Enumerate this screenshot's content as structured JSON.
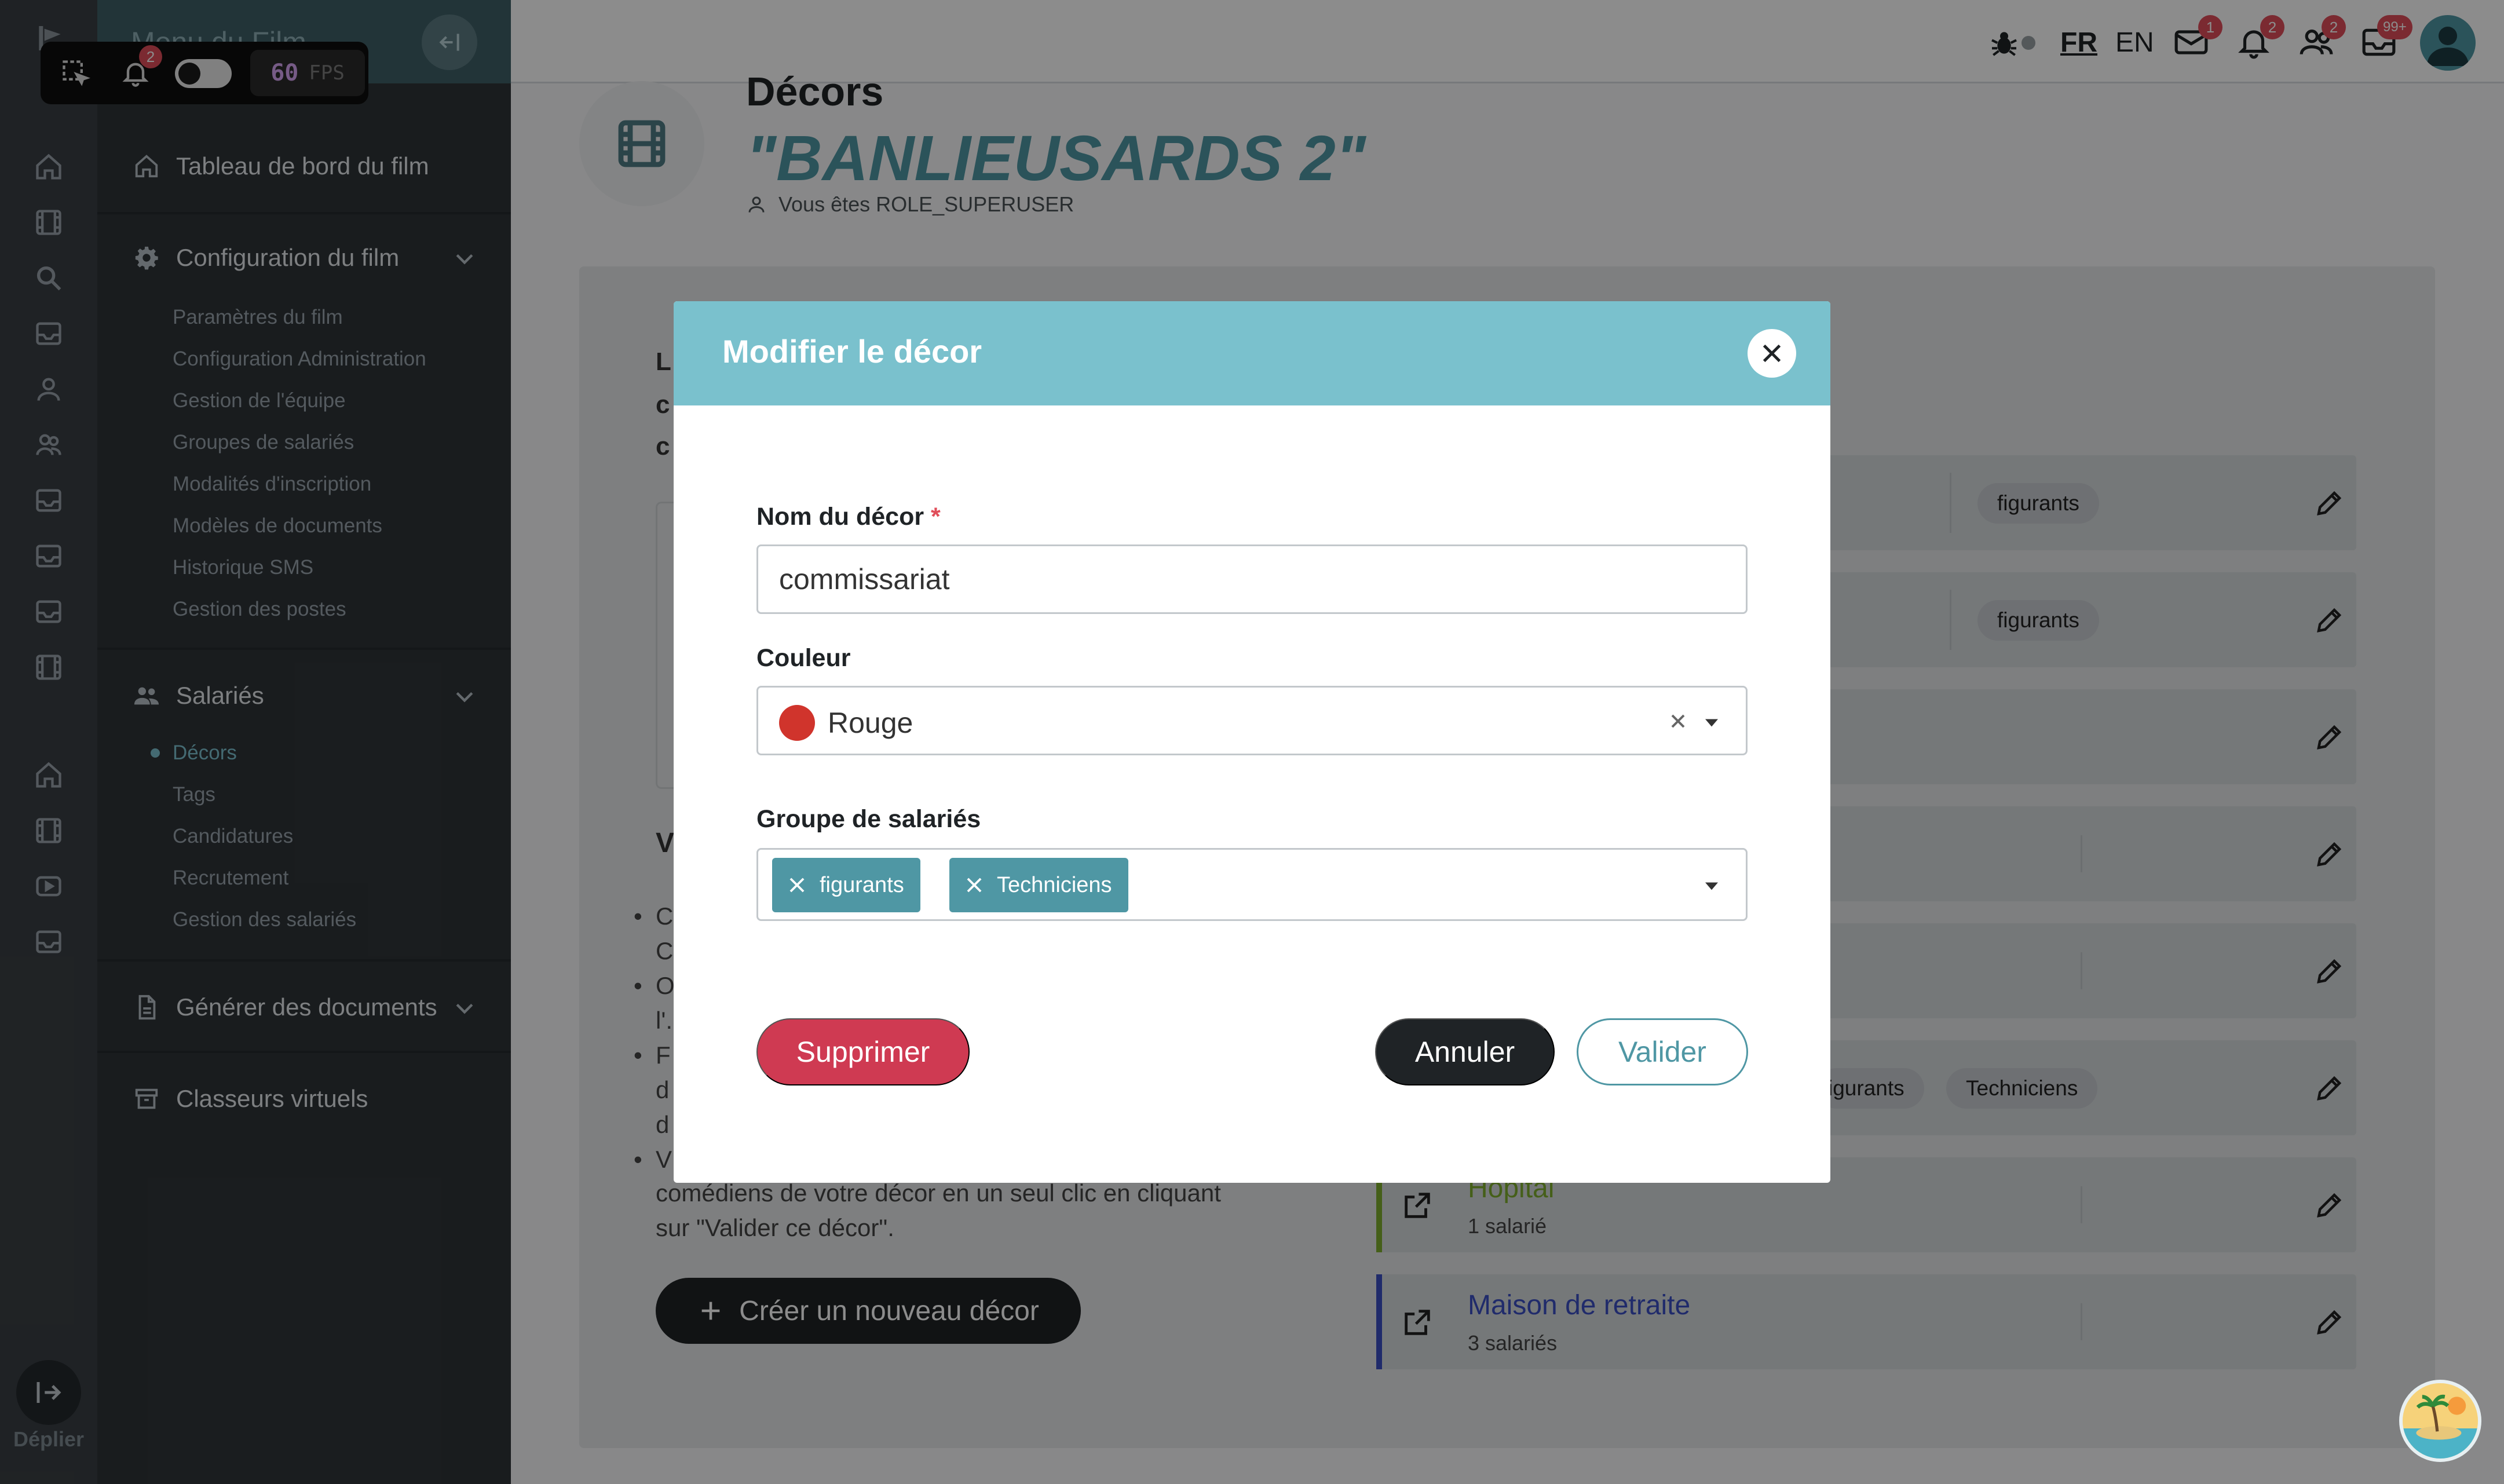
{
  "sidebar": {
    "header_title": "Menu du Film",
    "dashboard": "Tableau de bord du film",
    "config_section": "Configuration du film",
    "config_items": [
      "Paramètres du film",
      "Configuration Administration",
      "Gestion de l'équipe",
      "Groupes de salariés",
      "Modalités d'inscription",
      "Modèles de documents",
      "Historique SMS",
      "Gestion des postes"
    ],
    "salaries_section": "Salariés",
    "salaries_items": [
      "Décors",
      "Tags",
      "Candidatures",
      "Recrutement",
      "Gestion des salariés"
    ],
    "documents_section": "Générer des documents",
    "binders_section": "Classeurs virtuels"
  },
  "rail": {
    "expand_label": "Déplier"
  },
  "fps": {
    "value": "60",
    "label": "FPS",
    "bell_badge": "2"
  },
  "topbar": {
    "lang_fr": "FR",
    "lang_en": "EN",
    "badges": {
      "messages": "1",
      "notifications": "2",
      "users": "2",
      "mail": "99+"
    }
  },
  "page": {
    "kicker": "Décors",
    "title": "\"BANLIEUSARDS 2\"",
    "role": "Vous êtes ROLE_SUPERUSER"
  },
  "content": {
    "frag_l": "L",
    "frag_c1": "c",
    "frag_c2": "c",
    "frag_v": "V",
    "bullet_frags": [
      "C",
      "C",
      "O",
      "l'.",
      "F",
      "d",
      "d",
      "V"
    ],
    "bottom_text_1": "comédiens de votre décor en un seul clic en cliquant",
    "bottom_text_2": "sur \"Valider ce décor\".",
    "create_button": "Créer un nouveau décor",
    "rows": [
      {
        "tags": [
          "figurants"
        ]
      },
      {
        "tags": [
          "figurants"
        ]
      },
      {
        "tags": []
      },
      {
        "tags": []
      },
      {
        "tags": []
      },
      {
        "tags": [
          "igurants",
          "Techniciens"
        ]
      },
      {
        "name": "Hopital",
        "count": "1 salarié",
        "color": "#7fae2e"
      },
      {
        "name": "Maison de retraite",
        "count": "3 salariés",
        "color": "#3b4fc4"
      }
    ]
  },
  "modal": {
    "title": "Modifier le décor",
    "name_label": "Nom du décor",
    "required_mark": "*",
    "name_value": "commissariat",
    "color_label": "Couleur",
    "color_value": "Rouge",
    "color_swatch": "#d0342c",
    "group_label": "Groupe de salariés",
    "group_tags": [
      "figurants",
      "Techniciens"
    ],
    "delete_button": "Supprimer",
    "cancel_button": "Annuler",
    "validate_button": "Valider"
  },
  "colors": {
    "accent": "#4f97a4",
    "header": "#7ac1cd",
    "danger": "#cf3a52",
    "dark": "#1f2326"
  }
}
